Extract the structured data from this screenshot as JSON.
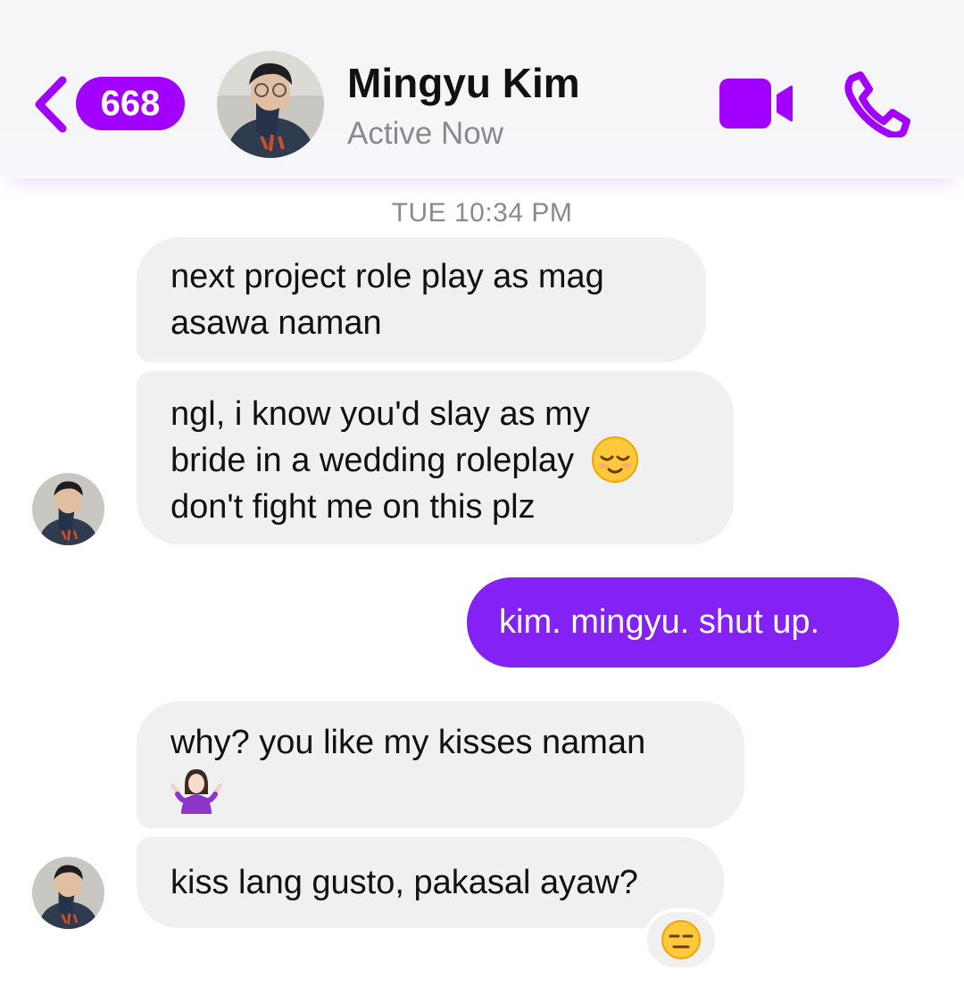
{
  "header": {
    "unread_count": "668",
    "contact_name": "Mingyu Kim",
    "status": "Active Now",
    "icons": [
      "back-chevron-icon",
      "video-call-icon",
      "phone-call-icon"
    ],
    "accent_color": "#a100ff"
  },
  "thread": {
    "timestamp": "TUE 10:34 PM",
    "messages": [
      {
        "sender": "contact",
        "lines": [
          "next project role play as mag",
          "asawa naman"
        ]
      },
      {
        "sender": "contact",
        "lines": [
          "ngl, i know you'd slay as my",
          "bride in a wedding roleplay",
          "don't fight me on this plz"
        ],
        "emoji": "relieved-face"
      },
      {
        "sender": "me",
        "lines": [
          "kim. mingyu. shut up."
        ]
      },
      {
        "sender": "contact",
        "lines": [
          "why? you like my kisses naman"
        ],
        "emoji": "woman-shrugging"
      },
      {
        "sender": "contact",
        "lines": [
          "kiss lang gusto, pakasal ayaw?"
        ],
        "reaction": "expressionless-face"
      }
    ],
    "outgoing_bubble_color": "#8422f5",
    "incoming_bubble_color": "#f0f0f0"
  }
}
